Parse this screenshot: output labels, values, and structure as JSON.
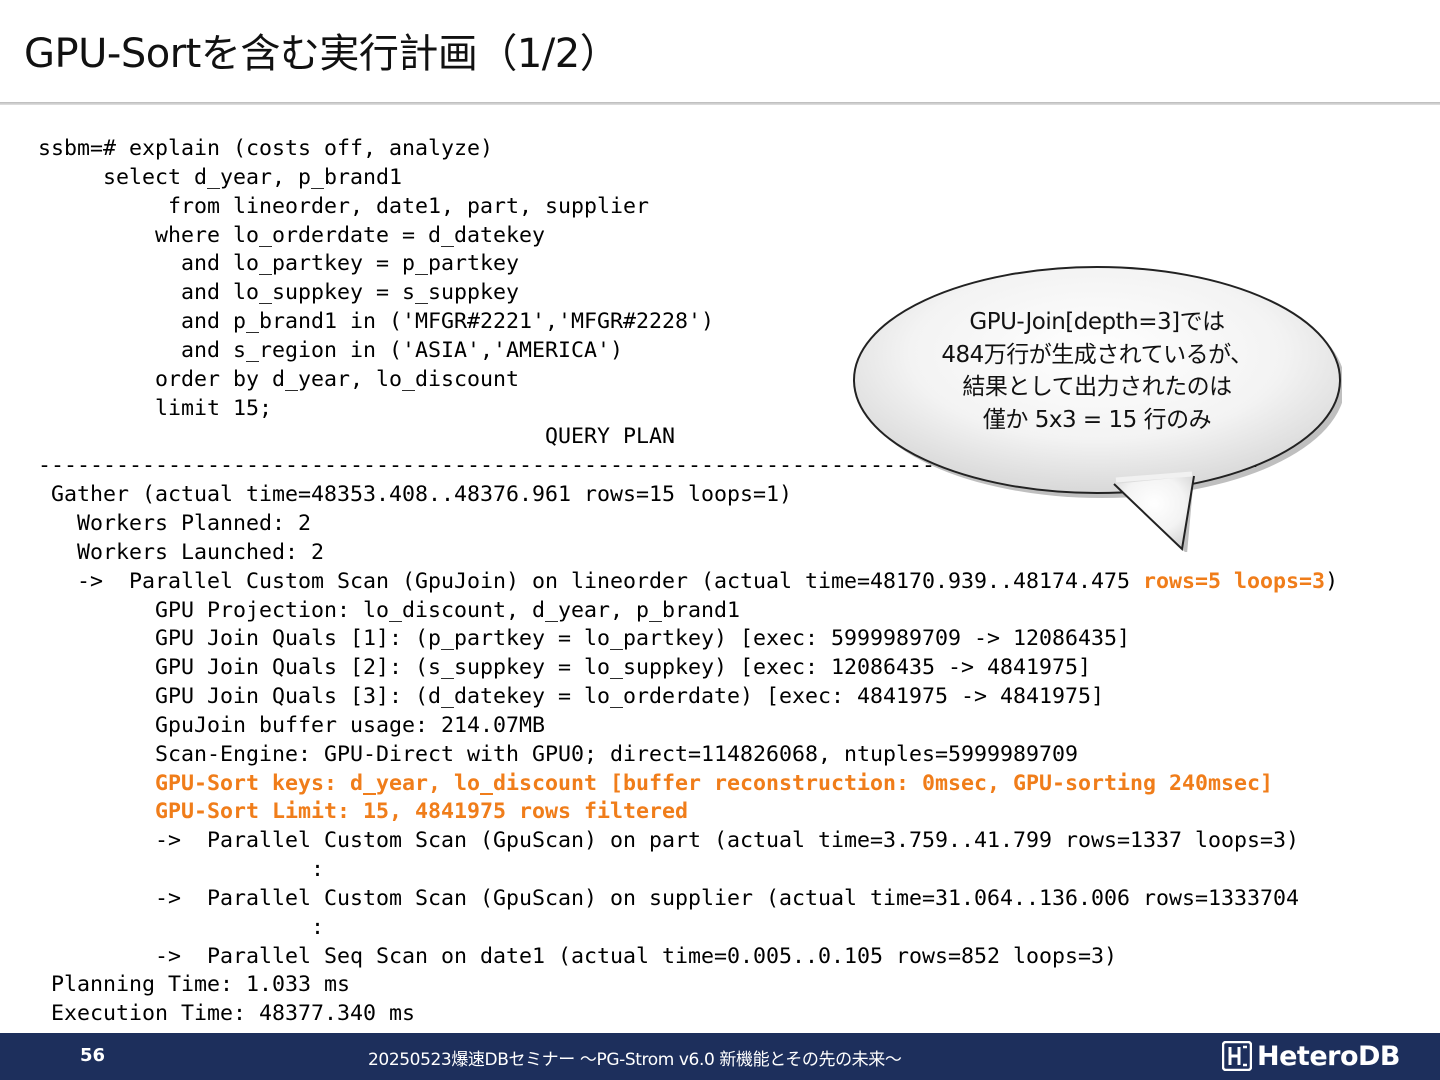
{
  "slide": {
    "title": "GPU-Sortを含む実行計画（1/2）"
  },
  "code": {
    "lines": [
      {
        "text": "ssbm=# explain (costs off, analyze)"
      },
      {
        "text": "     select d_year, p_brand1"
      },
      {
        "text": "          from lineorder, date1, part, supplier"
      },
      {
        "text": "         where lo_orderdate = d_datekey"
      },
      {
        "text": "           and lo_partkey = p_partkey"
      },
      {
        "text": "           and lo_suppkey = s_suppkey"
      },
      {
        "text": "           and p_brand1 in ('MFGR#2221','MFGR#2228')"
      },
      {
        "text": "           and s_region in ('ASIA','AMERICA')"
      },
      {
        "text": "         order by d_year, lo_discount"
      },
      {
        "text": "         limit 15;"
      },
      {
        "text": "                                       QUERY PLAN"
      },
      {
        "text": "----------------------------------------------------------------------------------------------"
      },
      {
        "text": " Gather (actual time=48353.408..48376.961 rows=15 loops=1)"
      },
      {
        "text": "   Workers Planned: 2"
      },
      {
        "text": "   Workers Launched: 2"
      },
      {
        "text": "   ->  Parallel Custom Scan (GpuJoin) on lineorder (actual time=48170.939..48174.475 ",
        "hl": "rows=5 loops=3",
        "after": ")"
      },
      {
        "text": "         GPU Projection: lo_discount, d_year, p_brand1"
      },
      {
        "text": "         GPU Join Quals [1]: (p_partkey = lo_partkey) [exec: 5999989709 -> 12086435]"
      },
      {
        "text": "         GPU Join Quals [2]: (s_suppkey = lo_suppkey) [exec: 12086435 -> 4841975]"
      },
      {
        "text": "         GPU Join Quals [3]: (d_datekey = lo_orderdate) [exec: 4841975 -> 4841975]"
      },
      {
        "text": "         GpuJoin buffer usage: 214.07MB"
      },
      {
        "text": "         Scan-Engine: GPU-Direct with GPU0; direct=114826068, ntuples=5999989709"
      },
      {
        "text": "         ",
        "hl": "GPU-Sort keys: d_year, lo_discount [buffer reconstruction: 0msec, GPU-sorting 240msec]"
      },
      {
        "text": "         ",
        "hl": "GPU-Sort Limit: 15, 4841975 rows filtered"
      },
      {
        "text": "         ->  Parallel Custom Scan (GpuScan) on part (actual time=3.759..41.799 rows=1337 loops=3)"
      },
      {
        "text": "                     :"
      },
      {
        "text": "         ->  Parallel Custom Scan (GpuScan) on supplier (actual time=31.064..136.006 rows=1333704"
      },
      {
        "text": "                     :"
      },
      {
        "text": "         ->  Parallel Seq Scan on date1 (actual time=0.005..0.105 rows=852 loops=3)"
      },
      {
        "text": " Planning Time: 1.033 ms"
      },
      {
        "text": " Execution Time: 48377.340 ms"
      }
    ]
  },
  "callout": {
    "lines": [
      "GPU-Join[depth=3]では",
      "484万行が生成されているが、",
      "結果として出力されたのは",
      "僅か 5x3 = 15 行のみ"
    ]
  },
  "footer": {
    "page_number": "56",
    "text": "20250523爆速DBセミナー ～PG-Strom v6.0  新機能とその先の未来～",
    "logo_text": "HeteroDB"
  },
  "colors": {
    "highlight": "#f07d1a",
    "footer_background": "#1d2f5c"
  },
  "icons": {
    "logo_mark": "heterodb-logo-icon"
  }
}
